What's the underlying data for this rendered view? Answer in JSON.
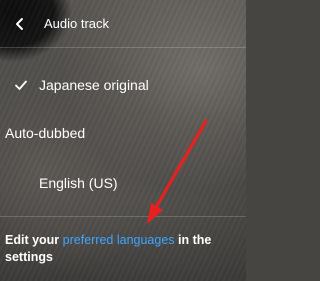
{
  "header": {
    "title": "Audio track",
    "back_icon": "chevron-left-icon"
  },
  "tracks": [
    {
      "label": "Japanese original",
      "selected": true
    }
  ],
  "auto_dubbed": {
    "label": "Auto-dubbed",
    "items": [
      {
        "label": "English (US)",
        "selected": false
      }
    ]
  },
  "footer": {
    "text_before": "Edit your ",
    "link_text": "preferred languages",
    "text_after": " in the settings",
    "link_color": "#3ea6ff"
  },
  "annotation": {
    "type": "arrow",
    "color": "#e8211f"
  }
}
